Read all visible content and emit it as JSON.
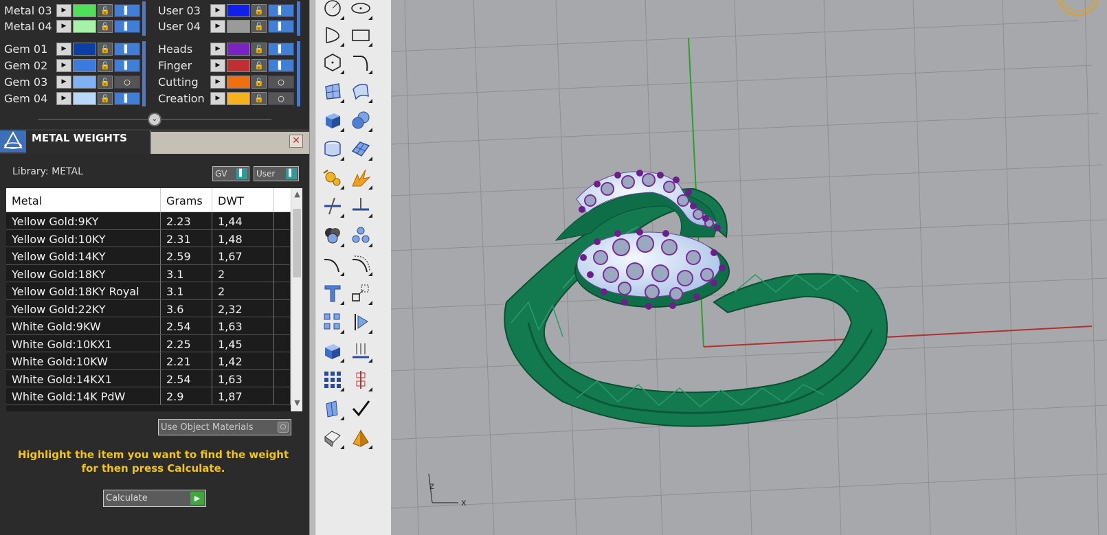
{
  "layers": {
    "left_group1": [
      {
        "name": "Metal 03",
        "color": "#4fe05a"
      },
      {
        "name": "Metal 04",
        "color": "#a6f2a6"
      }
    ],
    "right_group1": [
      {
        "name": "User 03",
        "color": "#1020e8"
      },
      {
        "name": "User 04",
        "color": "#9a9a9a"
      }
    ],
    "left_group2": [
      {
        "name": "Gem 01",
        "color": "#0b3fa6"
      },
      {
        "name": "Gem 02",
        "color": "#3b7be0"
      },
      {
        "name": "Gem 03",
        "color": "#7fb1f5"
      },
      {
        "name": "Gem 04",
        "color": "#b9d6fb"
      }
    ],
    "right_group2": [
      {
        "name": "Heads",
        "color": "#7a22c2"
      },
      {
        "name": "Finger",
        "color": "#c03030"
      },
      {
        "name": "Cutting",
        "color": "#f07010"
      },
      {
        "name": "Creation",
        "color": "#f5b21c"
      }
    ],
    "lock_glyph": "🔓",
    "expand_glyph": "▶",
    "visible_glyph": "▌",
    "hidden_glyph": "○"
  },
  "panel": {
    "title": "METAL WEIGHTS",
    "icon": "rhino-tool-icon",
    "close_glyph": "✕",
    "library_label": "Library: METAL",
    "gv_label": "GV",
    "user_label": "User",
    "toggle_glyph": "▌",
    "splitter_glyph": "⌄"
  },
  "table": {
    "headers": [
      "Metal",
      "Grams",
      "DWT"
    ],
    "rows": [
      [
        "Yellow Gold:9KY",
        "2.23",
        "1,44"
      ],
      [
        "Yellow Gold:10KY",
        "2.31",
        "1,48"
      ],
      [
        "Yellow Gold:14KY",
        "2.59",
        "1,67"
      ],
      [
        "Yellow Gold:18KY",
        "3.1",
        "2"
      ],
      [
        "Yellow Gold:18KY Royal",
        "3.1",
        "2"
      ],
      [
        "Yellow Gold:22KY",
        "3.6",
        "2,32"
      ],
      [
        "White Gold:9KW",
        "2.54",
        "1,63"
      ],
      [
        "White Gold:10KX1",
        "2.25",
        "1,45"
      ],
      [
        "White Gold:10KW",
        "2.21",
        "1,42"
      ],
      [
        "White Gold:14KX1",
        "2.54",
        "1,63"
      ],
      [
        "White Gold:14K PdW",
        "2.9",
        "1,87"
      ]
    ],
    "scroll_up": "▲",
    "scroll_down": "▼"
  },
  "use_object_materials": "Use Object Materials",
  "use_object_glyph": "○",
  "hint": "Highlight the item you want to find the weight for then press Calculate.",
  "calculate": {
    "label": "Calculate",
    "glyph": "▶"
  },
  "axis": {
    "z_label": "z",
    "x_label": "x"
  },
  "colors": {
    "ring": "#137a50",
    "gem_light": "#cfe0f5",
    "gem_purple": "#7a2a9a",
    "axis_x": "#b03030",
    "axis_y": "#2aa02a"
  },
  "tools": [
    "circle-icon",
    "ellipse-icon",
    "arc-icon",
    "rectangle-icon",
    "polygon-icon",
    "curve-icon",
    "surface-points-icon",
    "surface-patch-icon",
    "box-solid-icon",
    "sphere-union-icon",
    "cylinder-icon",
    "mesh-icon",
    "gear-explode-icon",
    "burst-icon",
    "trim-icon",
    "split-icon",
    "boolean-union-icon",
    "boolean-dots-icon",
    "fillet-curve-icon",
    "offset-curve-icon",
    "text-icon",
    "scale-icon",
    "array-icon",
    "mirror-icon",
    "extrude-icon",
    "project-icon",
    "grid-array-icon",
    "align-icon",
    "group-icon",
    "checkmark-icon",
    "render-icon",
    "pyramid-icon"
  ]
}
